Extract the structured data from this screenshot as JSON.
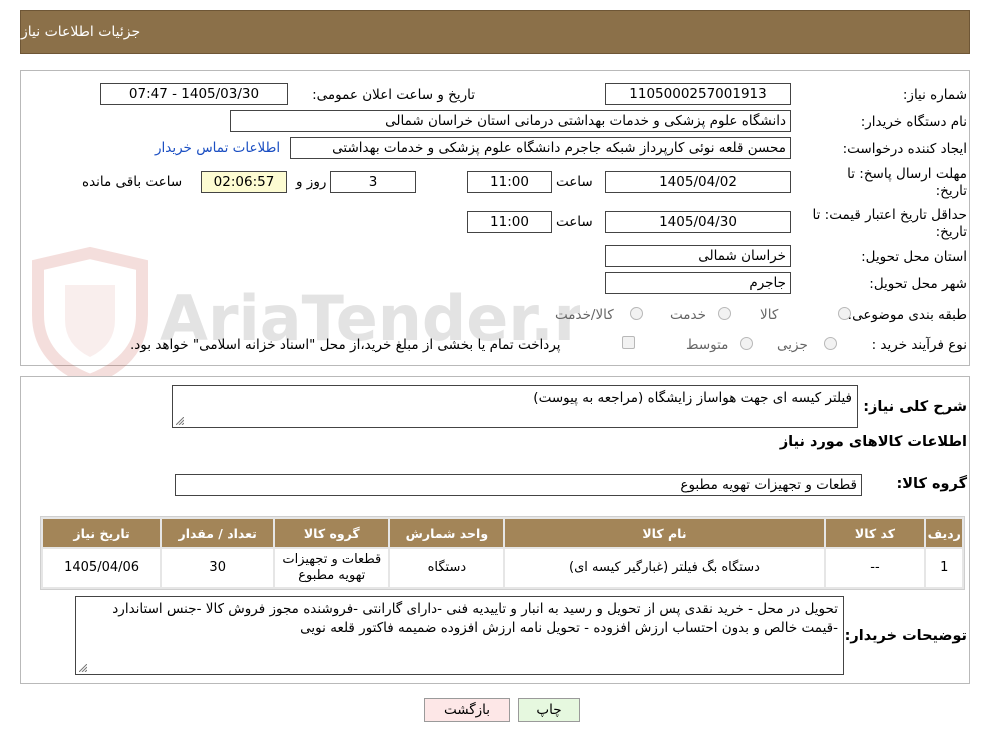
{
  "header": {
    "title": "جزئیات اطلاعات نیاز"
  },
  "form": {
    "need_number_label": "شماره نیاز:",
    "need_number": "1105000257001913",
    "announce_label": "تاریخ و ساعت اعلان عمومی:",
    "announce_value": "1405/03/30 - 07:47",
    "buyer_label": "نام دستگاه خریدار:",
    "buyer_value": "دانشگاه علوم پزشکی و خدمات بهداشتی درمانی استان خراسان شمالی",
    "creator_label": "ایجاد کننده درخواست:",
    "creator_value": "محسن قلعه نوئی کارپرداز شبکه جاجرم دانشگاه علوم پزشکی و خدمات بهداشتی",
    "contact_link": "اطلاعات تماس خریدار",
    "deadline_label_1": "مهلت ارسال پاسخ: تا",
    "deadline_label_2": "تاریخ:",
    "deadline_date": "1405/04/02",
    "time_label": "ساعت",
    "deadline_time": "11:00",
    "days_value": "3",
    "days_label": "روز و",
    "remaining_time": "02:06:57",
    "remaining_label": "ساعت باقی مانده",
    "validity_label_1": "حداقل تاریخ اعتبار قیمت: تا",
    "validity_label_2": "تاریخ:",
    "validity_date": "1405/04/30",
    "validity_time": "11:00",
    "province_label": "استان محل تحویل:",
    "province_value": "خراسان شمالی",
    "city_label": "شهر محل تحویل:",
    "city_value": "جاجرم",
    "category_label": "طبقه بندی موضوعی:",
    "category_options": [
      "کالا",
      "خدمت",
      "کالا/خدمت"
    ],
    "process_label": "نوع فرآیند خرید :",
    "process_options": [
      "جزیی",
      "متوسط"
    ],
    "treasury_note": "پرداخت تمام یا بخشی از مبلغ خرید،از محل \"اسناد خزانه اسلامی\" خواهد بود."
  },
  "watermark": {
    "text": "AriaTender.neT"
  },
  "summary": {
    "label": "شرح کلی نیاز:",
    "value": "فیلتر کیسه ای جهت هواساز زایشگاه (مراجعه به پیوست)"
  },
  "goods": {
    "section_title": "اطلاعات کالاهای مورد نیاز",
    "group_label": "گروه کالا:",
    "group_value": "قطعات و تجهیزات تهویه مطبوع"
  },
  "table": {
    "headers": [
      "ردیف",
      "کد کالا",
      "نام کالا",
      "واحد شمارش",
      "گروه کالا",
      "تعداد / مقدار",
      "تاریخ نیاز"
    ],
    "rows": [
      {
        "row": "1",
        "code": "--",
        "name": "دستگاه بگ فیلتر (غبارگیر کیسه ای)",
        "unit": "دستگاه",
        "group": "قطعات و تجهیزات تهویه مطبوع",
        "qty": "30",
        "date": "1405/04/06"
      }
    ]
  },
  "buyer_notes": {
    "label": "توضیحات خریدار:",
    "value": "تحویل در محل - خرید نقدی پس از تحویل و رسید به انبار و تاییدیه فنی -دارای گارانتی -فروشنده مجوز فروش کالا -جنس استاندارد -قیمت خالص و بدون احتساب ارزش افزوده - تحویل نامه ارزش افزوده ضمیمه فاکتور قلعه نویی"
  },
  "buttons": {
    "print": "چاپ",
    "back": "بازگشت"
  },
  "colors": {
    "header_bg": "#8b7049",
    "table_header_bg": "#a38558",
    "link": "#1a4ec2",
    "back_btn_bg": "#fde7e7",
    "print_btn_bg": "#e6f8df"
  }
}
